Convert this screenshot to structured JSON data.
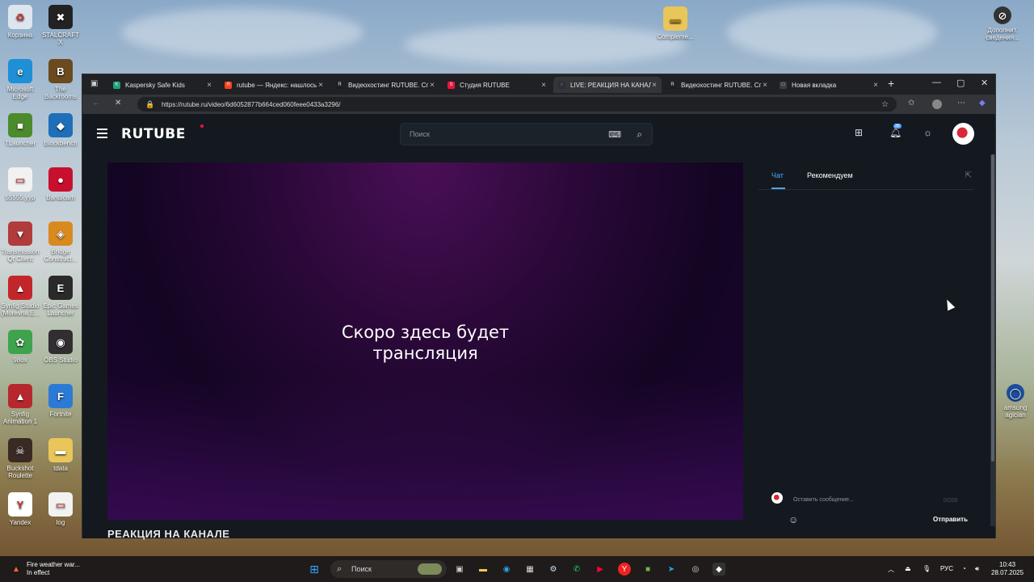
{
  "desktop": {
    "icons": [
      {
        "label": "Корзина",
        "glyph": "♻",
        "color": "#dde6ef"
      },
      {
        "label": "STALCRAFT X",
        "glyph": "✖",
        "color": "#222222"
      },
      {
        "label": "Microsoft Edge",
        "glyph": "e",
        "color": "#1f8fd6"
      },
      {
        "label": "The Backrooms",
        "glyph": "B",
        "color": "#6b4a1f"
      },
      {
        "label": "TLauncher",
        "glyph": "■",
        "color": "#4c8b2b"
      },
      {
        "label": "Blockbench",
        "glyph": "◆",
        "color": "#1f6fb8"
      },
      {
        "label": "55555.ууp",
        "glyph": "▭",
        "color": "#f2f2f2"
      },
      {
        "label": "Bandicam",
        "glyph": "●",
        "color": "#c8102e"
      },
      {
        "label": "Transmission Qt Client",
        "glyph": "▼",
        "color": "#b23b3b"
      },
      {
        "label": "Bridge Construct...",
        "glyph": "◈",
        "color": "#d98a1f"
      },
      {
        "label": "Synfig Studio (Morevna E...",
        "glyph": "▲",
        "color": "#c2262b"
      },
      {
        "label": "Epic Games Launcher",
        "glyph": "E",
        "color": "#2a2a2a"
      },
      {
        "label": "98ox",
        "glyph": "✿",
        "color": "#3fa34d"
      },
      {
        "label": "OBS Studio",
        "glyph": "◉",
        "color": "#302e31"
      },
      {
        "label": "Synfig Animation 1",
        "glyph": "▲",
        "color": "#b7282e"
      },
      {
        "label": "Fortnite",
        "glyph": "F",
        "color": "#2b7bd6"
      },
      {
        "label": "Buckshot Roulette",
        "glyph": "☠",
        "color": "#3a2a24"
      },
      {
        "label": "tdata",
        "glyph": "▬",
        "color": "#e8c65a"
      },
      {
        "label": "Yandex",
        "glyph": "Y",
        "color": "#ffffff"
      },
      {
        "label": "log",
        "glyph": "▭",
        "color": "#f2f2f2"
      }
    ],
    "top_right_folder": "Compleme...",
    "top_right_app": "Дополнит. сведения...",
    "right_edge_label": "amsung agician"
  },
  "browser": {
    "tabs": [
      {
        "label": "Kaspersky Safe Kids",
        "fav_color": "#1aa37a",
        "fav": "K"
      },
      {
        "label": "rutube — Яндекс: нашлось",
        "fav_color": "#fc3f1d",
        "fav": "Я"
      },
      {
        "label": "Видеохостинг RUTUBE. Сг",
        "fav_color": "#1b1f24",
        "fav": "R"
      },
      {
        "label": "Студия RUTUBE",
        "fav_color": "#ed143b",
        "fav": "S"
      },
      {
        "label": "LIVE: РЕАКЦИЯ НА КАНАЛ",
        "fav_color": "#2a3038",
        "fav": "◌"
      },
      {
        "label": "Видеохостинг RUTUBE. Сг",
        "fav_color": "#1b1f24",
        "fav": "R"
      },
      {
        "label": "Новая вкладка",
        "fav_color": "#3a3d42",
        "fav": "□"
      }
    ],
    "url": "https://rutube.ru/video/6d6052877b664ced060feee0433a3296/"
  },
  "rutube": {
    "logo": "RUTUBE",
    "search_placeholder": "Поиск",
    "notification_count": "30",
    "player_message_line1": "Скоро здесь будет",
    "player_message_line2": "трансляция",
    "stream_title": "РЕАКЦИЯ НА КАНАЛЕ",
    "side_tabs": {
      "chat": "Чат",
      "recommended": "Рекомендуем"
    },
    "chat_placeholder": "Оставить сообщение...",
    "chat_counter": "0/200",
    "send_label": "Отправить",
    "accent": "#4fa3ff"
  },
  "taskbar": {
    "weather_title": "Fire weather war...",
    "weather_sub": "In effect",
    "search_label": "Поиск",
    "lang": "РУС",
    "time": "10:43",
    "date": "28.07.2025"
  }
}
